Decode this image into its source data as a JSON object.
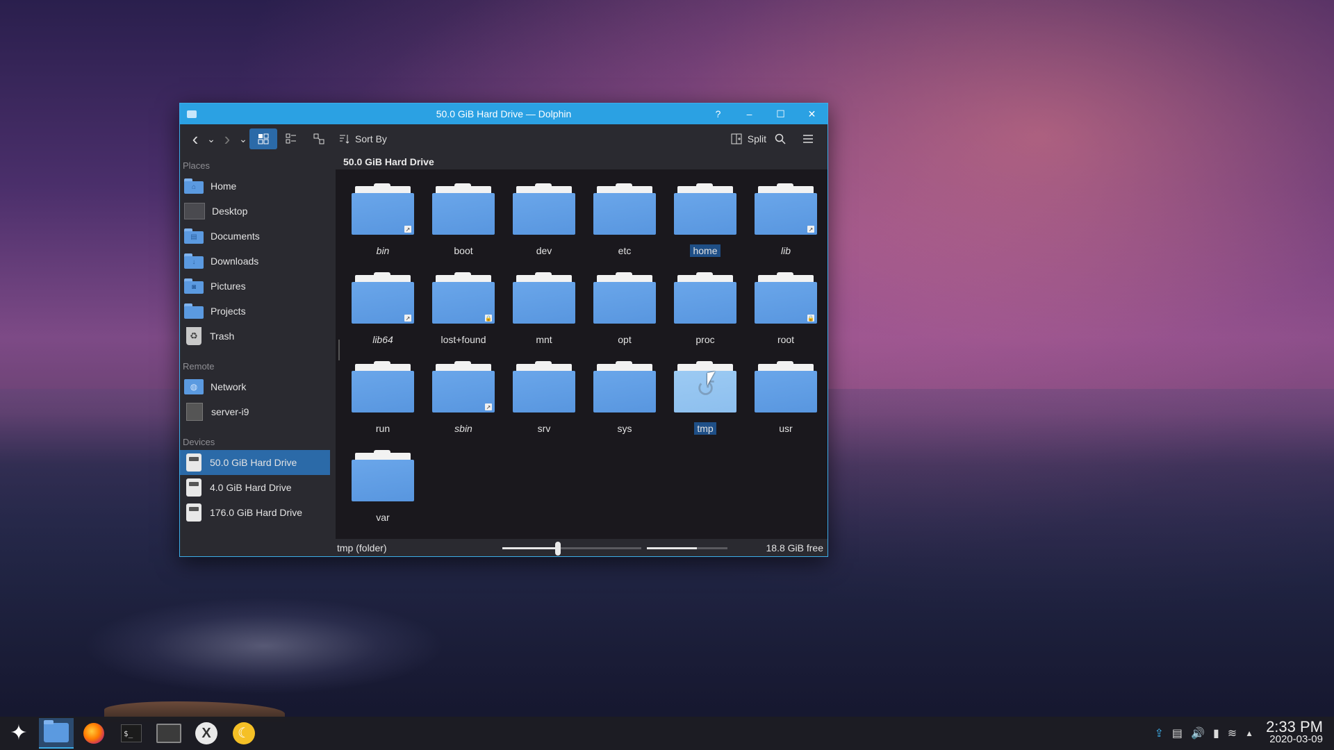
{
  "window": {
    "title": "50.0 GiB Hard Drive — Dolphin",
    "help_glyph": "?",
    "min_glyph": "–",
    "max_glyph": "☐",
    "close_glyph": "✕"
  },
  "toolbar": {
    "back_glyph": "‹",
    "down_glyph": "⌄",
    "forward_glyph": "›",
    "sort_label": "Sort By",
    "split_label": "Split",
    "search_glyph": "⚲",
    "menu_glyph": "≡"
  },
  "sidebar": {
    "places_label": "Places",
    "places": [
      {
        "label": "Home",
        "glyph": "⌂"
      },
      {
        "label": "Desktop",
        "glyph": ""
      },
      {
        "label": "Documents",
        "glyph": "▤"
      },
      {
        "label": "Downloads",
        "glyph": "↓"
      },
      {
        "label": "Pictures",
        "glyph": "◙"
      },
      {
        "label": "Projects",
        "glyph": ""
      },
      {
        "label": "Trash",
        "glyph": "♻"
      }
    ],
    "remote_label": "Remote",
    "remote": [
      {
        "label": "Network",
        "glyph": "◍"
      },
      {
        "label": "server-i9"
      }
    ],
    "devices_label": "Devices",
    "devices": [
      {
        "label": "50.0 GiB Hard Drive"
      },
      {
        "label": "4.0 GiB Hard Drive"
      },
      {
        "label": "176.0 GiB Hard Drive"
      }
    ]
  },
  "breadcrumb": "50.0 GiB Hard Drive",
  "folders": [
    {
      "name": "bin",
      "italic": true,
      "badge": "↗"
    },
    {
      "name": "boot"
    },
    {
      "name": "dev"
    },
    {
      "name": "etc"
    },
    {
      "name": "home",
      "selected": true
    },
    {
      "name": "lib",
      "italic": true,
      "badge": "↗"
    },
    {
      "name": "lib64",
      "italic": true,
      "badge": "↗"
    },
    {
      "name": "lost+found",
      "badge": "🔒"
    },
    {
      "name": "mnt"
    },
    {
      "name": "opt"
    },
    {
      "name": "proc"
    },
    {
      "name": "root",
      "badge": "🔒"
    },
    {
      "name": "run"
    },
    {
      "name": "sbin",
      "italic": true,
      "badge": "↗"
    },
    {
      "name": "srv"
    },
    {
      "name": "sys"
    },
    {
      "name": "tmp",
      "selected": true,
      "hover": true
    },
    {
      "name": "usr"
    },
    {
      "name": "var"
    }
  ],
  "history_glyph": "↺",
  "status": {
    "text": "tmp (folder)",
    "free": "18.8 GiB free",
    "zoom_level": 0.4,
    "disk_free_fraction": 0.62
  },
  "taskbar": {
    "launcher_glyph": "✦",
    "terminal_glyph": "$_",
    "x_glyph": "X",
    "y_glyph": "☾",
    "tray": {
      "updates_glyph": "⇪",
      "clipboard_glyph": "▤",
      "volume_glyph": "🔊",
      "battery_glyph": "▮",
      "network_glyph": "≋",
      "expand_glyph": "▲"
    },
    "time": "2:33 PM",
    "date": "2020-03-09"
  },
  "colors": {
    "accent": "#3daee9",
    "titlebar": "#2ba1e3",
    "selection": "#2b6aa8",
    "folder": "#5b9ae0"
  }
}
